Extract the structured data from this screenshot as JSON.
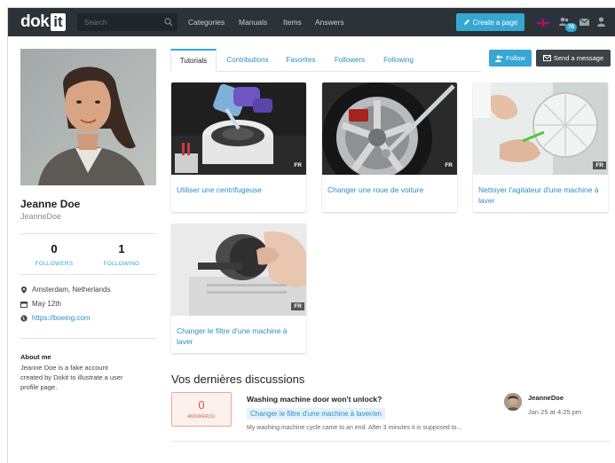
{
  "topbar": {
    "logo_word": "dok",
    "logo_box": "it",
    "search_placeholder": "Search",
    "nav": [
      "Categories",
      "Manuals",
      "Items",
      "Answers"
    ],
    "create_label": "Create a page",
    "notif_count": "79"
  },
  "profile": {
    "name": "Jeanne Doe",
    "username": "JeanneDoe",
    "followers_count": "0",
    "followers_label": "FOLLOWERS",
    "following_count": "1",
    "following_label": "FOLLOWING",
    "location": "Amsterdam, Netherlands",
    "date": "May 12th",
    "website": "https://boeing.com",
    "about_heading": "About me",
    "about_text": "Jeanne Doe is a fake account created by Dokit to illustrate a user profile page."
  },
  "tabs": [
    "Tutorials",
    "Contributions",
    "Favorites",
    "Followers",
    "Following"
  ],
  "actions": {
    "follow": "Follow",
    "message": "Send a message"
  },
  "cards": [
    {
      "title": "Utiliser une centrifugeuse",
      "lang": "FR"
    },
    {
      "title": "Changer une roue de voiture",
      "lang": "FR"
    },
    {
      "title": "Nettoyer l'agitateur d'une machine à laver",
      "lang": "FR"
    },
    {
      "title": "Changer le filtre d'une machine à laver",
      "lang": "FR"
    }
  ],
  "discussions": {
    "heading": "Vos dernières discussions",
    "item": {
      "answers_count": "0",
      "answers_label": "ANSWER(S)",
      "title": "Washing machine door won't unlock?",
      "tag": "Changer le filtre d'une machine à laver/en",
      "excerpt": "My washing machine cycle came to an end. After 3 minutes it is supposed to...",
      "user": "JeanneDoe",
      "date": "Jan 25 at 4:25 pm"
    }
  },
  "colors": {
    "topbar": "#2b3338",
    "accent": "#36a7d3",
    "link": "#2a8fbf",
    "answers": "#d9533d"
  }
}
